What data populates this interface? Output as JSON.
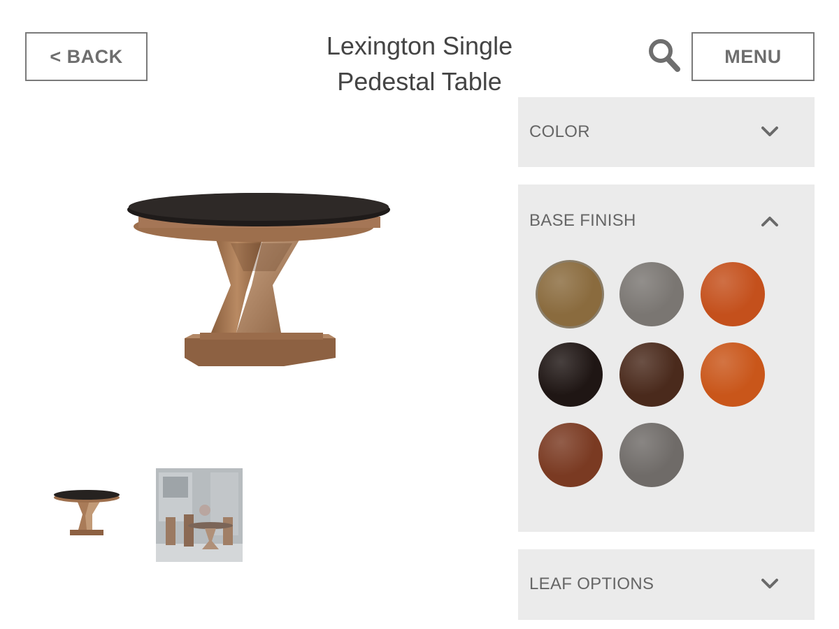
{
  "header": {
    "back_label": "< BACK",
    "title_line1": "Lexington Single",
    "title_line2": "Pedestal Table",
    "menu_label": "MENU",
    "search_icon": "search-icon"
  },
  "options": [
    {
      "label": "COLOR",
      "state": "collapsed",
      "icon": "chevron-down-icon"
    },
    {
      "label": "BASE FINISH",
      "state": "expanded",
      "icon": "chevron-up-icon",
      "swatches": [
        {
          "color": "#8a6b3e",
          "selected": true
        },
        {
          "color": "#7a7672",
          "selected": false
        },
        {
          "color": "#c4501c",
          "selected": false
        },
        {
          "color": "#1f1614",
          "selected": false
        },
        {
          "color": "#4a2a1c",
          "selected": false
        },
        {
          "color": "#c9561a",
          "selected": false
        },
        {
          "color": "#7a3a22",
          "selected": false
        },
        {
          "color": "#6f6b68",
          "selected": false
        }
      ]
    },
    {
      "label": "LEAF OPTIONS",
      "state": "collapsed",
      "icon": "chevron-down-icon"
    }
  ],
  "colors": {
    "panel_bg": "#ebebeb",
    "button_border": "#7a7a7a",
    "text": "#666666",
    "tabletop": "#2a2624",
    "wood": "#9a6f4c"
  }
}
